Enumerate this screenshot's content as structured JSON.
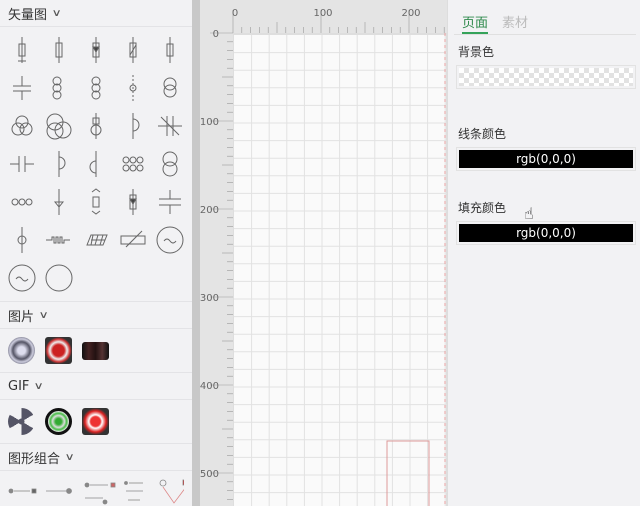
{
  "left_panel": {
    "sections": [
      {
        "title": "矢量图",
        "icon_count": 32
      },
      {
        "title": "图片"
      },
      {
        "title": "GIF"
      },
      {
        "title": "图形组合"
      }
    ]
  },
  "ruler": {
    "top_labels": [
      "0",
      "100",
      "200"
    ],
    "left_labels": [
      "0",
      "100",
      "200",
      "300",
      "400",
      "500"
    ]
  },
  "right_panel": {
    "tabs": [
      {
        "label": "页面",
        "active": true
      },
      {
        "label": "素材",
        "active": false
      }
    ],
    "background_label": "背景色",
    "line_color_label": "线条颜色",
    "line_color_value": "rgb(0,0,0)",
    "fill_color_label": "填充颜色",
    "fill_color_value": "rgb(0,0,0)"
  },
  "colors": {
    "accent": "#35a35a",
    "canvas_guide": "#e8a0a0"
  }
}
